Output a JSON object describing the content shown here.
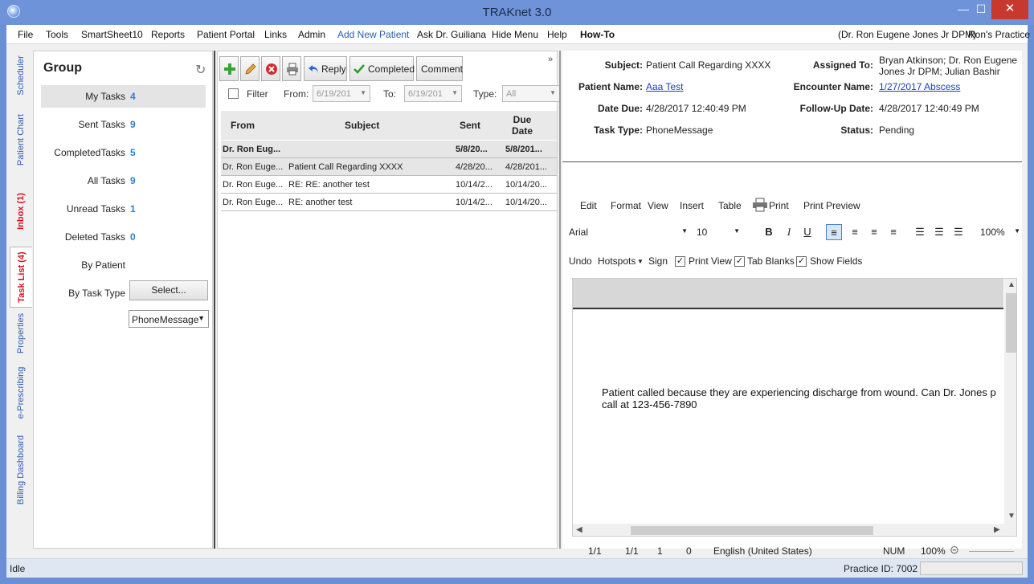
{
  "window": {
    "title": "TRAKnet 3.0",
    "minimize": "—",
    "maximize": "☐",
    "close": "✕"
  },
  "menu": {
    "items": [
      "File",
      "Tools",
      "SmartSheet10",
      "Reports",
      "Patient Portal",
      "Links",
      "Admin",
      "Add New Patient",
      "Ask Dr. Guiliana",
      "Hide Menu",
      "Help",
      "How-To"
    ],
    "user": "(Dr. Ron Eugene Jones Jr DPM)",
    "practice": "Ron's Practice"
  },
  "side_tabs": [
    "Scheduler",
    "Patient Chart",
    "Inbox (1)",
    "Task List (4)",
    "Properties",
    "e-Prescribing",
    "Billing Dashboard"
  ],
  "group": {
    "title": "Group",
    "rows": [
      {
        "label": "My Tasks",
        "count": "4"
      },
      {
        "label": "Sent Tasks",
        "count": "9"
      },
      {
        "label": "CompletedTasks",
        "count": "5"
      },
      {
        "label": "All Tasks",
        "count": "9"
      },
      {
        "label": "Unread Tasks",
        "count": "1"
      },
      {
        "label": "Deleted Tasks",
        "count": "0"
      }
    ],
    "by_patient_label": "By Patient",
    "select_button": "Select...",
    "by_task_type_label": "By Task Type",
    "task_type_value": "PhoneMessage"
  },
  "toolbar": {
    "reply": "Reply",
    "completed": "Completed",
    "comment": "Comment",
    "expand": "»"
  },
  "filter": {
    "label": "Filter",
    "from_label": "From:",
    "from_value": "6/19/201",
    "to_label": "To:",
    "to_value": "6/19/201",
    "type_label": "Type:",
    "type_value": "All"
  },
  "table": {
    "headers": {
      "from": "From",
      "subject": "Subject",
      "sent": "Sent",
      "due1": "Due",
      "due2": "Date"
    },
    "group_row": {
      "from": "Dr. Ron Eug...",
      "sent": "5/8/20...",
      "due": "5/8/201..."
    },
    "rows": [
      {
        "from": "Dr. Ron Euge...",
        "subject": "Patient Call Regarding XXXX",
        "sent": "4/28/20...",
        "due": "4/28/201..."
      },
      {
        "from": "Dr. Ron Euge...",
        "subject": "RE: RE: another test",
        "sent": "10/14/2...",
        "due": "10/14/20..."
      },
      {
        "from": "Dr. Ron Euge...",
        "subject": "RE: another test",
        "sent": "10/14/2...",
        "due": "10/14/20..."
      }
    ]
  },
  "detail": {
    "subject_label": "Subject:",
    "subject": "Patient Call Regarding XXXX",
    "assigned_label": "Assigned To:",
    "assigned_line1": "Bryan Atkinson; Dr. Ron Eugene",
    "assigned_line2": "Jones Jr DPM; Julian Bashir",
    "patient_label": "Patient Name:",
    "patient": "Aaa Test",
    "encounter_label": "Encounter Name:",
    "encounter": "1/27/2017 Abscess",
    "due_label": "Date Due:",
    "due": "4/28/2017 12:40:49 PM",
    "followup_label": "Follow-Up Date:",
    "followup": "4/28/2017 12:40:49 PM",
    "type_label": "Task Type:",
    "type": "PhoneMessage",
    "status_label": "Status:",
    "status": "Pending"
  },
  "editor": {
    "menu": {
      "edit": "Edit",
      "format": "Format",
      "view": "View",
      "insert": "Insert",
      "table": "Table",
      "print": "Print",
      "print_preview": "Print Preview"
    },
    "font": "Arial",
    "size": "10",
    "zoom_select": "100%",
    "options": {
      "undo": "Undo",
      "hotspots": "Hotspots",
      "sign": "Sign",
      "print_view": "Print View",
      "tab_blanks": "Tab Blanks",
      "show_fields": "Show Fields"
    },
    "body_line1": "Patient called because they are experiencing discharge from wound. Can Dr. Jones p",
    "body_line2": "call at 123-456-7890",
    "status": {
      "page": "1/1",
      "section": "1/1",
      "line": "1",
      "col": "0",
      "language": "English (United States)",
      "num": "NUM",
      "zoom": "100%"
    }
  },
  "statusbar": {
    "state": "Idle",
    "practice_id": "Practice ID: 7002"
  },
  "colors": {
    "accent": "#2f7fd1",
    "link": "#1a3fc0",
    "title_bar": "#6f93d9",
    "alert": "#d10f1a"
  }
}
